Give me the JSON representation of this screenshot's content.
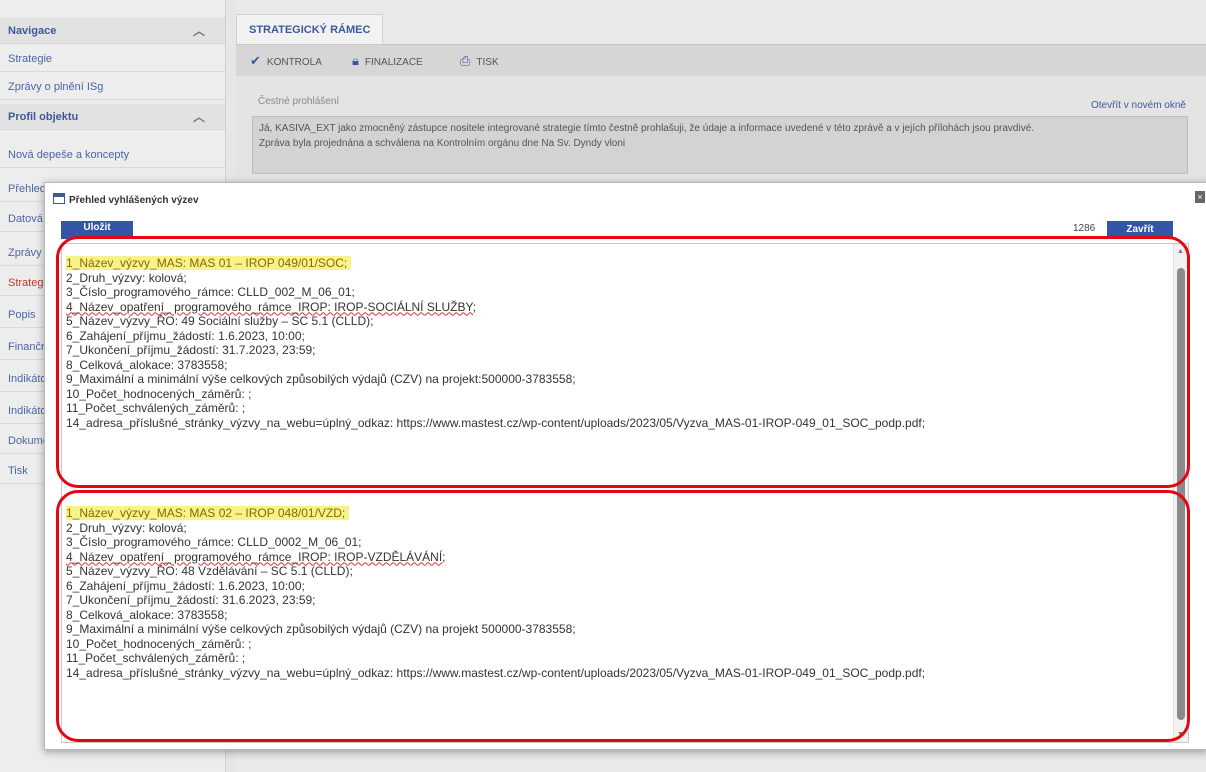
{
  "sidebar": {
    "items": [
      {
        "label": "Navigace",
        "head": true
      },
      {
        "label": "Strategie"
      },
      {
        "label": "Zprávy o plnění ISg"
      },
      {
        "label": "Profil objektu",
        "head": true
      },
      {
        "label": "Nová depeše a koncepty"
      },
      {
        "label": "Přehled"
      },
      {
        "label": "Datová"
      },
      {
        "label": "Zprávy"
      },
      {
        "label": "Strategický",
        "active": true
      },
      {
        "label": "Popis"
      },
      {
        "label": "Finanční"
      },
      {
        "label": "Indikátory"
      },
      {
        "label": "Indikátory"
      },
      {
        "label": "Dokumenty"
      },
      {
        "label": "Tisk"
      }
    ]
  },
  "app": {
    "title": "STRATEGICKÝ RÁMEC",
    "toolbar": {
      "check": "KONTROLA",
      "finalize": "FINALIZACE",
      "print": "TISK"
    },
    "panel_label": "Čestné prohlášení",
    "panel_link": "Otevřít v novém okně",
    "panel_text_1": "Já, KASIVA_EXT jako zmocněný zástupce nositele integrované strategie tímto čestně prohlašuji, že údaje a informace uvedené v této zprávě a v jejích přílohách jsou pravdivé.",
    "panel_text_2": "Zpráva byla projednána a schválena na Kontrolním orgánu dne Na Sv. Dyndy vloni"
  },
  "modal": {
    "title": "Přehled vyhlášených výzev",
    "close_x": "×",
    "left_button": "Uložit",
    "counter": "1286",
    "close_button": "Zavřít"
  },
  "records": [
    {
      "lines": [
        "1_Název_výzvy_MAS: MAS 01 – IROP 049/01/SOC;",
        "2_Druh_výzvy: kolová;",
        "3_Číslo_programového_rámce: CLLD_002_M_06_01;",
        "4_Název_opatření_ programového_rámce_IROP: IROP-SOCIÁLNÍ  SLUŽBY;",
        "5_Název_výzvy_ŘO: 49 Sociální služby – SC 5.1 (CLLD);",
        "6_Zahájení_příjmu_žádostí: 1.6.2023, 10:00;",
        "7_Ukončení_příjmu_žádostí: 31.7.2023, 23:59;",
        "8_Celková_alokace: 3783558;",
        "9_Maximální a minimální výše celkových způsobilých výdajů (CZV) na projekt:500000-3783558;",
        "10_Počet_hodnocených_záměrů: ;",
        "11_Počet_schválených_záměrů: ;",
        "14_adresa_příslušné_stránky_výzvy_na_webu=úplný_odkaz: https://www.mastest.cz/wp-content/uploads/2023/05/Vyzva_MAS-01-IROP-049_01_SOC_podp.pdf;"
      ]
    },
    {
      "lines": [
        "1_Název_výzvy_MAS: MAS 02 – IROP 048/01/VZD;",
        "2_Druh_výzvy: kolová;",
        "3_Číslo_programového_rámce: CLLD_0002_M_06_01;",
        "4_Název_opatření_ programového_rámce_IROP: IROP-VZDĚLÁVÁNÍ;",
        "5_Název_výzvy_ŘO:  48 Vzdělávání – SC 5.1 (CLLD);",
        "6_Zahájení_příjmu_žádostí: 1.6.2023, 10:00;",
        "7_Ukončení_příjmu_žádostí: 31.6.2023, 23:59;",
        "8_Celková_alokace: 3783558;",
        "9_Maximální a minimální výše celkových způsobilých výdajů (CZV) na projekt 500000-3783558;",
        "10_Počet_hodnocených_záměrů: ;",
        "11_Počet_schválených_záměrů: ;",
        "14_adresa_příslušné_stránky_výzvy_na_webu=úplný_odkaz: https://www.mastest.cz/wp-content/uploads/2023/05/Vyzva_MAS-01-IROP-049_01_SOC_podp.pdf;"
      ]
    }
  ],
  "colors": {
    "highlight": "#f7f28a",
    "outline": "#e30613",
    "button": "#3454a8"
  }
}
